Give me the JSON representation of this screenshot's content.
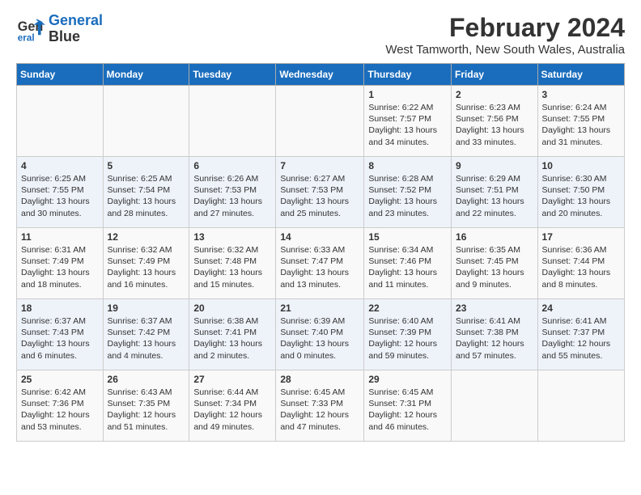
{
  "logo": {
    "line1": "General",
    "line2": "Blue"
  },
  "title": "February 2024",
  "subtitle": "West Tamworth, New South Wales, Australia",
  "days_header": [
    "Sunday",
    "Monday",
    "Tuesday",
    "Wednesday",
    "Thursday",
    "Friday",
    "Saturday"
  ],
  "weeks": [
    [
      {
        "num": "",
        "info": ""
      },
      {
        "num": "",
        "info": ""
      },
      {
        "num": "",
        "info": ""
      },
      {
        "num": "",
        "info": ""
      },
      {
        "num": "1",
        "info": "Sunrise: 6:22 AM\nSunset: 7:57 PM\nDaylight: 13 hours\nand 34 minutes."
      },
      {
        "num": "2",
        "info": "Sunrise: 6:23 AM\nSunset: 7:56 PM\nDaylight: 13 hours\nand 33 minutes."
      },
      {
        "num": "3",
        "info": "Sunrise: 6:24 AM\nSunset: 7:55 PM\nDaylight: 13 hours\nand 31 minutes."
      }
    ],
    [
      {
        "num": "4",
        "info": "Sunrise: 6:25 AM\nSunset: 7:55 PM\nDaylight: 13 hours\nand 30 minutes."
      },
      {
        "num": "5",
        "info": "Sunrise: 6:25 AM\nSunset: 7:54 PM\nDaylight: 13 hours\nand 28 minutes."
      },
      {
        "num": "6",
        "info": "Sunrise: 6:26 AM\nSunset: 7:53 PM\nDaylight: 13 hours\nand 27 minutes."
      },
      {
        "num": "7",
        "info": "Sunrise: 6:27 AM\nSunset: 7:53 PM\nDaylight: 13 hours\nand 25 minutes."
      },
      {
        "num": "8",
        "info": "Sunrise: 6:28 AM\nSunset: 7:52 PM\nDaylight: 13 hours\nand 23 minutes."
      },
      {
        "num": "9",
        "info": "Sunrise: 6:29 AM\nSunset: 7:51 PM\nDaylight: 13 hours\nand 22 minutes."
      },
      {
        "num": "10",
        "info": "Sunrise: 6:30 AM\nSunset: 7:50 PM\nDaylight: 13 hours\nand 20 minutes."
      }
    ],
    [
      {
        "num": "11",
        "info": "Sunrise: 6:31 AM\nSunset: 7:49 PM\nDaylight: 13 hours\nand 18 minutes."
      },
      {
        "num": "12",
        "info": "Sunrise: 6:32 AM\nSunset: 7:49 PM\nDaylight: 13 hours\nand 16 minutes."
      },
      {
        "num": "13",
        "info": "Sunrise: 6:32 AM\nSunset: 7:48 PM\nDaylight: 13 hours\nand 15 minutes."
      },
      {
        "num": "14",
        "info": "Sunrise: 6:33 AM\nSunset: 7:47 PM\nDaylight: 13 hours\nand 13 minutes."
      },
      {
        "num": "15",
        "info": "Sunrise: 6:34 AM\nSunset: 7:46 PM\nDaylight: 13 hours\nand 11 minutes."
      },
      {
        "num": "16",
        "info": "Sunrise: 6:35 AM\nSunset: 7:45 PM\nDaylight: 13 hours\nand 9 minutes."
      },
      {
        "num": "17",
        "info": "Sunrise: 6:36 AM\nSunset: 7:44 PM\nDaylight: 13 hours\nand 8 minutes."
      }
    ],
    [
      {
        "num": "18",
        "info": "Sunrise: 6:37 AM\nSunset: 7:43 PM\nDaylight: 13 hours\nand 6 minutes."
      },
      {
        "num": "19",
        "info": "Sunrise: 6:37 AM\nSunset: 7:42 PM\nDaylight: 13 hours\nand 4 minutes."
      },
      {
        "num": "20",
        "info": "Sunrise: 6:38 AM\nSunset: 7:41 PM\nDaylight: 13 hours\nand 2 minutes."
      },
      {
        "num": "21",
        "info": "Sunrise: 6:39 AM\nSunset: 7:40 PM\nDaylight: 13 hours\nand 0 minutes."
      },
      {
        "num": "22",
        "info": "Sunrise: 6:40 AM\nSunset: 7:39 PM\nDaylight: 12 hours\nand 59 minutes."
      },
      {
        "num": "23",
        "info": "Sunrise: 6:41 AM\nSunset: 7:38 PM\nDaylight: 12 hours\nand 57 minutes."
      },
      {
        "num": "24",
        "info": "Sunrise: 6:41 AM\nSunset: 7:37 PM\nDaylight: 12 hours\nand 55 minutes."
      }
    ],
    [
      {
        "num": "25",
        "info": "Sunrise: 6:42 AM\nSunset: 7:36 PM\nDaylight: 12 hours\nand 53 minutes."
      },
      {
        "num": "26",
        "info": "Sunrise: 6:43 AM\nSunset: 7:35 PM\nDaylight: 12 hours\nand 51 minutes."
      },
      {
        "num": "27",
        "info": "Sunrise: 6:44 AM\nSunset: 7:34 PM\nDaylight: 12 hours\nand 49 minutes."
      },
      {
        "num": "28",
        "info": "Sunrise: 6:45 AM\nSunset: 7:33 PM\nDaylight: 12 hours\nand 47 minutes."
      },
      {
        "num": "29",
        "info": "Sunrise: 6:45 AM\nSunset: 7:31 PM\nDaylight: 12 hours\nand 46 minutes."
      },
      {
        "num": "",
        "info": ""
      },
      {
        "num": "",
        "info": ""
      }
    ]
  ]
}
